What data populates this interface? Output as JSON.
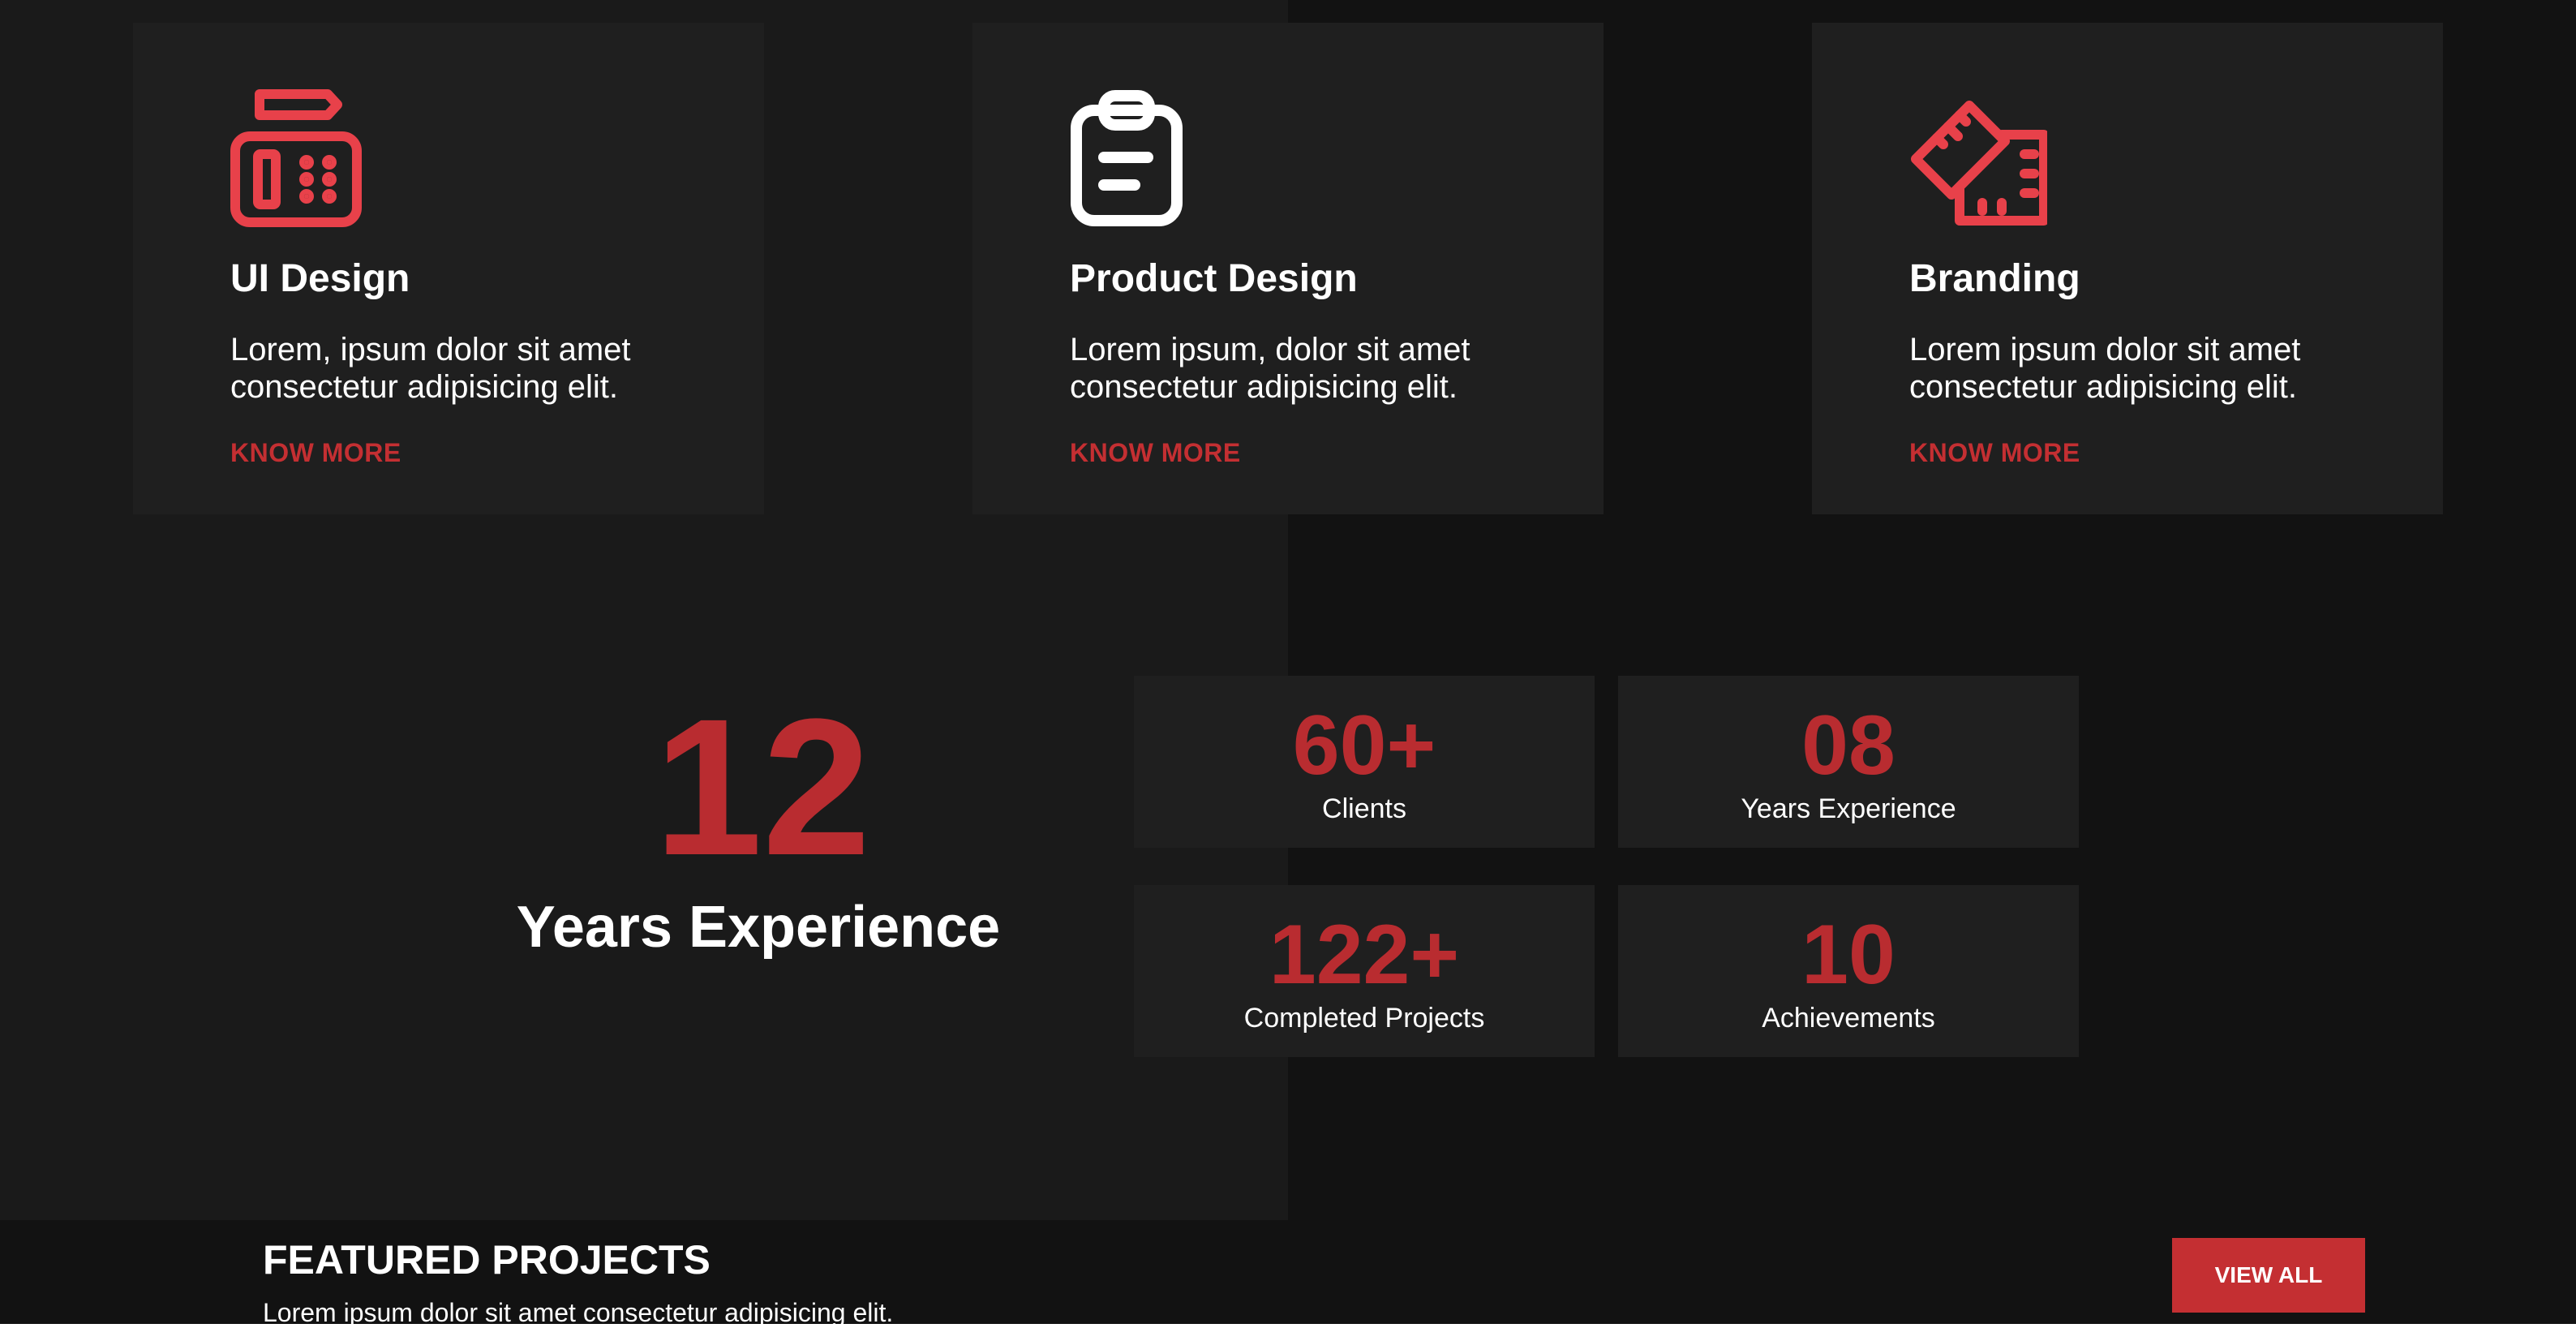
{
  "services": [
    {
      "title": "UI Design",
      "desc": "Lorem, ipsum dolor sit amet consectetur adipisicing elit.",
      "link": "KNOW MORE",
      "icon": "ui-design-icon",
      "icon_color": "#e8414a"
    },
    {
      "title": "Product Design",
      "desc": "Lorem ipsum, dolor sit amet consectetur adipisicing elit.",
      "link": "KNOW MORE",
      "icon": "clipboard-icon",
      "icon_color": "#ffffff"
    },
    {
      "title": "Branding",
      "desc": "Lorem ipsum dolor sit amet consectetur adipisicing elit.",
      "link": "KNOW MORE",
      "icon": "ruler-icon",
      "icon_color": "#e8414a"
    }
  ],
  "experience": {
    "number": "12",
    "label": "Years Experience"
  },
  "stats": [
    {
      "value": "60+",
      "label": "Clients"
    },
    {
      "value": "08",
      "label": "Years Experience"
    },
    {
      "value": "122+",
      "label": "Completed Projects"
    },
    {
      "value": "10",
      "label": "Achievements"
    }
  ],
  "featured": {
    "title": "FEATURED PROJECTS",
    "subtitle": "Lorem ipsum dolor sit amet consectetur adipisicing elit.",
    "button": "VIEW ALL"
  },
  "colors": {
    "accent": "#c42f32",
    "icon_red": "#e8414a",
    "card_bg": "#1f1f1f",
    "page_bg": "#1a1a1a"
  }
}
